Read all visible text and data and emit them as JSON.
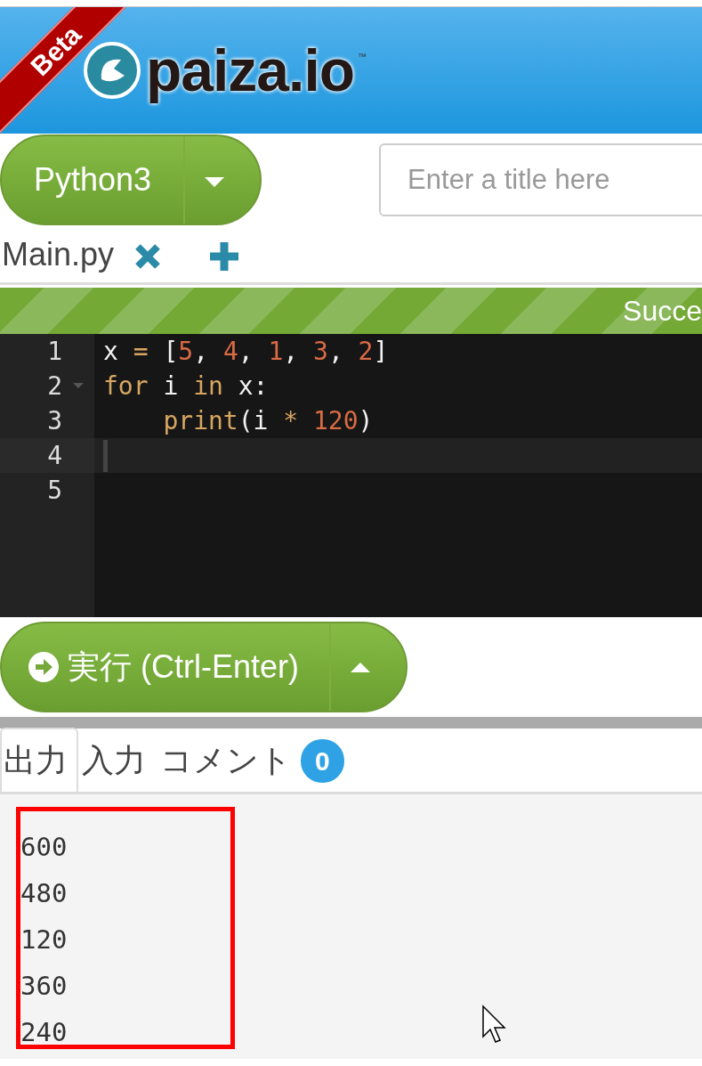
{
  "header": {
    "ribbon": "Beta",
    "logo": "paiza.io",
    "trademark": "™"
  },
  "language_button": {
    "label": "Python3"
  },
  "title_field": {
    "placeholder": "Enter a title here"
  },
  "file_tabs": [
    {
      "label": "Main.py",
      "selected": true
    }
  ],
  "status_bar": {
    "text": "Succe"
  },
  "editor": {
    "lines": [
      {
        "number": "1",
        "foldable": false,
        "selected": false,
        "tokens": [
          {
            "text": "x ",
            "kind": "plain"
          },
          {
            "text": "=",
            "kind": "keyword"
          },
          {
            "text": " [",
            "kind": "plain"
          },
          {
            "text": "5",
            "kind": "number"
          },
          {
            "text": ", ",
            "kind": "plain"
          },
          {
            "text": "4",
            "kind": "number"
          },
          {
            "text": ", ",
            "kind": "plain"
          },
          {
            "text": "1",
            "kind": "number"
          },
          {
            "text": ", ",
            "kind": "plain"
          },
          {
            "text": "3",
            "kind": "number"
          },
          {
            "text": ", ",
            "kind": "plain"
          },
          {
            "text": "2",
            "kind": "number"
          },
          {
            "text": "]",
            "kind": "plain"
          }
        ]
      },
      {
        "number": "2",
        "foldable": true,
        "selected": false,
        "tokens": [
          {
            "text": "for",
            "kind": "keyword"
          },
          {
            "text": " i ",
            "kind": "plain"
          },
          {
            "text": "in",
            "kind": "keyword"
          },
          {
            "text": " x:",
            "kind": "plain"
          }
        ]
      },
      {
        "number": "3",
        "foldable": false,
        "selected": false,
        "tokens": [
          {
            "text": "    print",
            "kind": "keyword"
          },
          {
            "text": "(i ",
            "kind": "plain"
          },
          {
            "text": "*",
            "kind": "keyword"
          },
          {
            "text": " 120",
            "kind": "number"
          },
          {
            "text": ")",
            "kind": "plain"
          }
        ]
      },
      {
        "number": "4",
        "foldable": false,
        "selected": true
      },
      {
        "number": "5",
        "foldable": false,
        "selected": false
      }
    ]
  },
  "run_button": {
    "label": "実行 (Ctrl-Enter)"
  },
  "output_tabs": [
    {
      "label": "出力",
      "selected": true
    },
    {
      "label": "入力",
      "selected": false
    },
    {
      "label": "コメント",
      "selected": false,
      "badge": "0"
    }
  ],
  "output": {
    "lines": [
      "600",
      "480",
      "120",
      "360",
      "240"
    ]
  }
}
